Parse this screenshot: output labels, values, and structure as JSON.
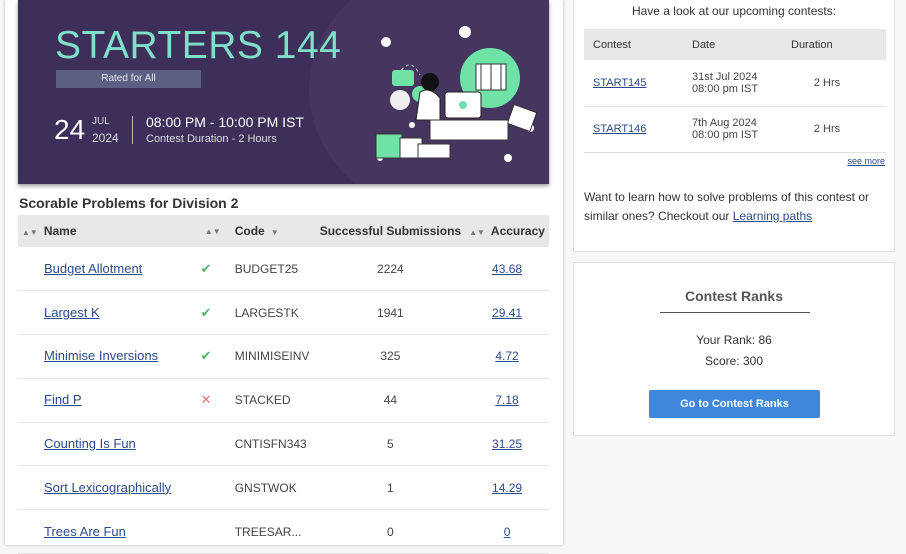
{
  "banner": {
    "title": "STARTERS 144",
    "rated": "Rated for All",
    "day": "24",
    "month": "JUL",
    "year": "2024",
    "time": "08:00 PM - 10:00 PM IST",
    "duration": "Contest Duration - 2  Hours"
  },
  "problems_section": {
    "title": "Scorable Problems for Division 2",
    "headers": {
      "name": "Name",
      "code": "Code",
      "submissions": "Successful Submissions",
      "accuracy": "Accuracy"
    },
    "rows": [
      {
        "name": "Budget Allotment",
        "status": "solved",
        "status_icon": "check-icon",
        "code": "BUDGET25",
        "submissions": "2224",
        "accuracy": "43.68"
      },
      {
        "name": "Largest K",
        "status": "solved",
        "status_icon": "check-icon",
        "code": "LARGESTK",
        "submissions": "1941",
        "accuracy": "29.41"
      },
      {
        "name": "Minimise Inversions",
        "status": "solved",
        "status_icon": "check-icon",
        "code": "MINIMISEINV",
        "submissions": "325",
        "accuracy": "4.72"
      },
      {
        "name": "Find P",
        "status": "wrong",
        "status_icon": "cross-icon",
        "code": "STACKED",
        "submissions": "44",
        "accuracy": "7.18"
      },
      {
        "name": "Counting Is Fun",
        "status": "",
        "status_icon": "",
        "code": "CNTISFN343",
        "submissions": "5",
        "accuracy": "31.25"
      },
      {
        "name": "Sort Lexicographically",
        "status": "",
        "status_icon": "",
        "code": "GNSTWOK",
        "submissions": "1",
        "accuracy": "14.29"
      },
      {
        "name": "Trees Are Fun",
        "status": "",
        "status_icon": "",
        "code": "TREESAR...",
        "submissions": "0",
        "accuracy": "0"
      }
    ]
  },
  "upcoming": {
    "heading": "Have a look at our upcoming contests:",
    "headers": {
      "contest": "Contest",
      "date": "Date",
      "duration": "Duration"
    },
    "rows": [
      {
        "contest": "START145",
        "date_line1": "31st Jul 2024",
        "date_line2": "08:00 pm IST",
        "duration": "2 Hrs"
      },
      {
        "contest": "START146",
        "date_line1": "7th Aug 2024",
        "date_line2": "08:00 pm IST",
        "duration": "2 Hrs"
      }
    ],
    "see_more": "see more",
    "learn_text": "Want to learn how to solve problems of this contest or similar ones? Checkout our",
    "learn_link": "Learning paths"
  },
  "ranks": {
    "title": "Contest Ranks",
    "your_rank": "Your Rank: 86",
    "score": "Score: 300",
    "button": "Go to Contest Ranks"
  },
  "colors": {
    "banner_bg": "#3d2f5a",
    "banner_title": "#7ee0c9",
    "link": "#2b4a8a",
    "success": "#52b060",
    "fail": "#e57373",
    "button": "#3f87dc"
  }
}
